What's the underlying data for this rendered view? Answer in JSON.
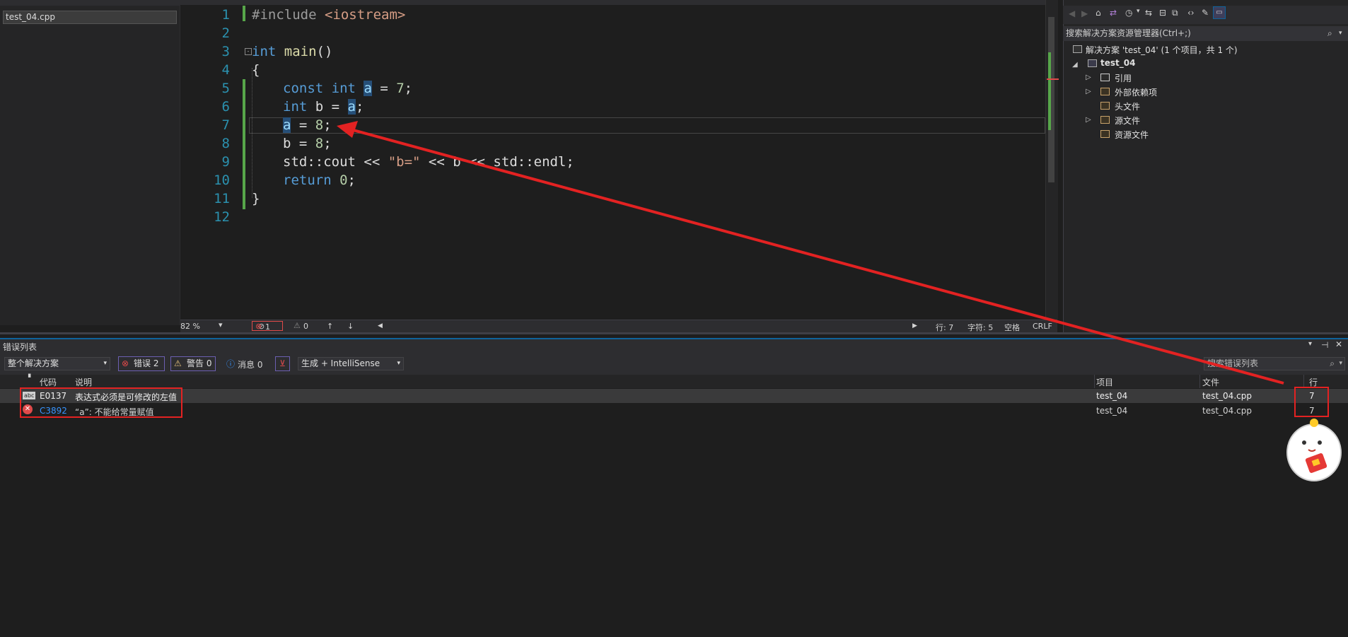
{
  "left_panel": {
    "file_name": "test_04.cpp"
  },
  "editor": {
    "line_numbers": [
      "1",
      "2",
      "3",
      "4",
      "5",
      "6",
      "7",
      "8",
      "9",
      "10",
      "11",
      "12"
    ],
    "code": {
      "l1_pp": "#include",
      "l1_header": "<iostream>",
      "l3_kw": "int",
      "l3_fn": "main",
      "l4": "{",
      "l5_kw1": "const",
      "l5_kw2": "int",
      "l5_var": "a",
      "l5_rest": " = ",
      "l5_num": "7",
      "l5_semi": ";",
      "l6_kw": "int",
      "l6_mid": " b = ",
      "l6_var": "a",
      "l6_semi": ";",
      "l7_var": "a",
      "l7_rest": " = ",
      "l7_num": "8",
      "l7_semi": ";",
      "l8_text": "b = ",
      "l8_num": "8",
      "l8_semi": ";",
      "l9_a": "std::cout << ",
      "l9_str": "\"b=\"",
      "l9_b": " << b << std::endl;",
      "l10_kw": "return",
      "l10_num": "0",
      "l10_semi": ";",
      "l11": "}"
    },
    "status": {
      "zoom": "82 %",
      "error_count": "1",
      "warning_count": "0",
      "line": "行: 7",
      "char": "字符: 5",
      "space": "空格",
      "eol": "CRLF"
    }
  },
  "solution_explorer": {
    "search_placeholder": "搜索解决方案资源管理器(Ctrl+;)",
    "solution": "解决方案 'test_04' (1 个项目，共 1 个)",
    "project": "test_04",
    "items": [
      "引用",
      "外部依赖项",
      "头文件",
      "源文件",
      "资源文件"
    ]
  },
  "error_list": {
    "title": "错误列表",
    "scope": "整个解决方案",
    "errors_btn": "错误 2",
    "warnings_btn": "警告 0",
    "messages_btn": "消息 0",
    "build_filter": "生成 + IntelliSense",
    "search_placeholder": "搜索错误列表",
    "columns": {
      "code": "代码",
      "desc": "说明",
      "project": "项目",
      "file": "文件",
      "line": "行"
    },
    "rows": [
      {
        "code": "E0137",
        "desc": "表达式必须是可修改的左值",
        "project": "test_04",
        "file": "test_04.cpp",
        "line": "7"
      },
      {
        "code": "C3892",
        "desc": "“a”: 不能给常量赋值",
        "project": "test_04",
        "file": "test_04.cpp",
        "line": "7"
      }
    ]
  },
  "colors": {
    "annotation": "#e32222",
    "keyword": "#569cd6",
    "line_number": "#2b91af"
  }
}
